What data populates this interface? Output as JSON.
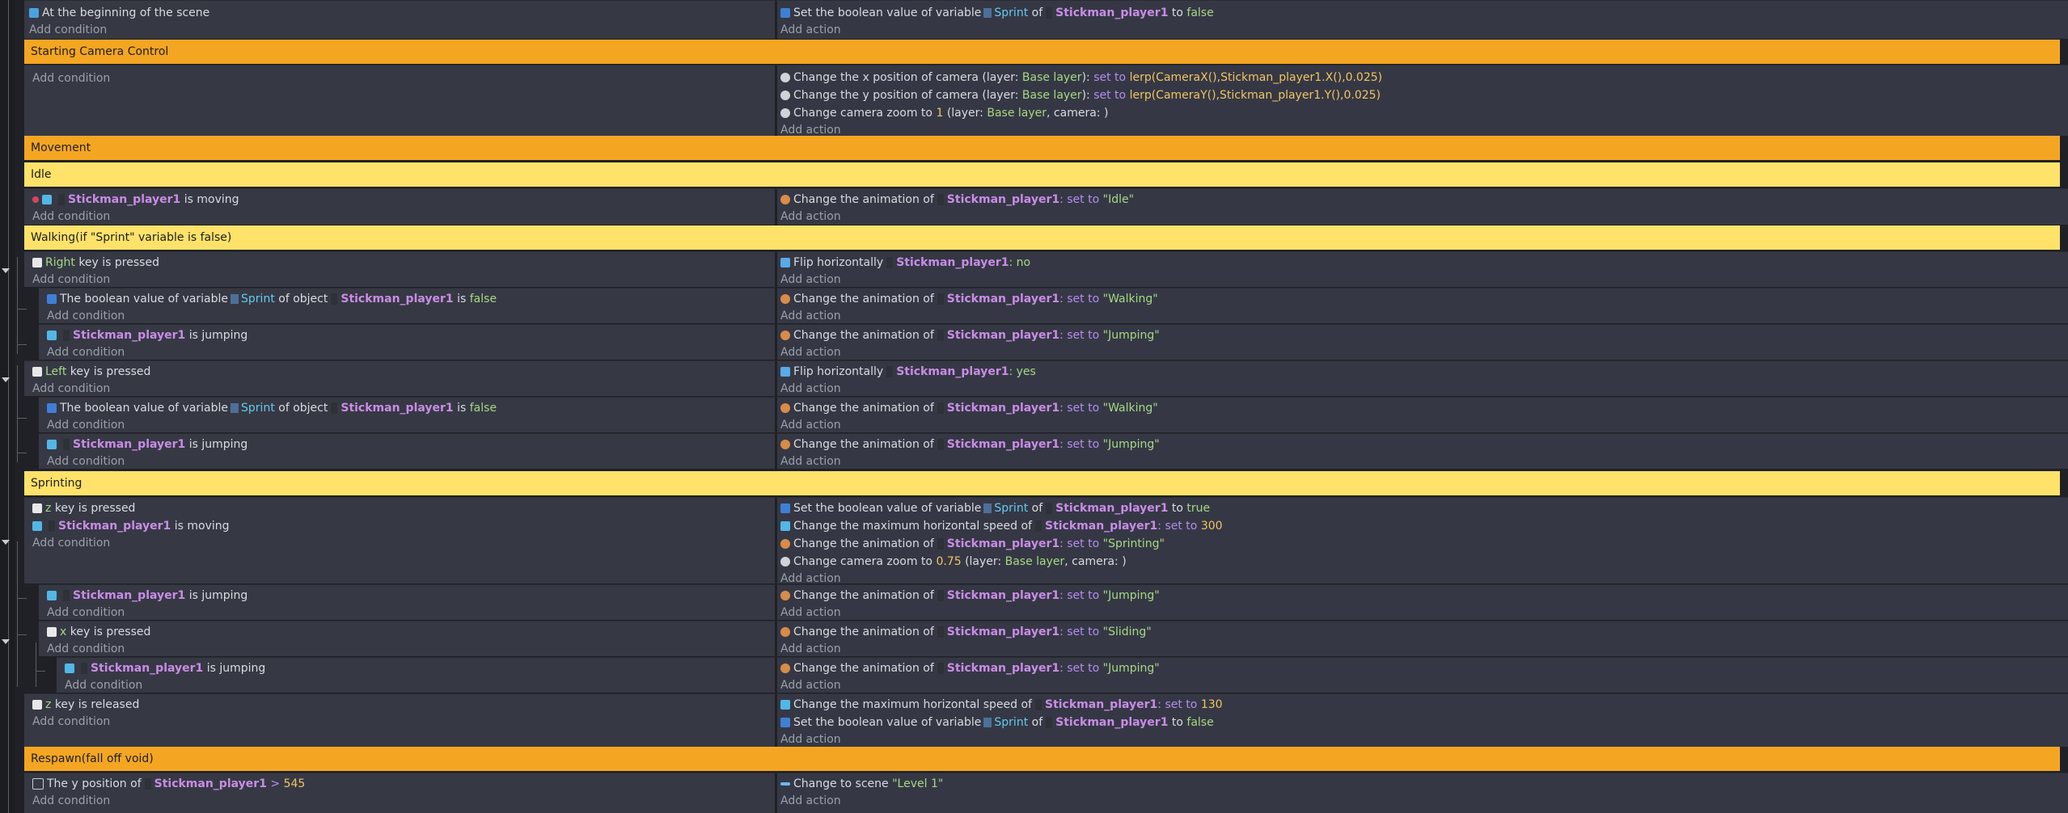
{
  "add_condition": "Add condition",
  "add_action": "Add action",
  "events": {
    "e1": {
      "cond_text": "At the beginning of the scene",
      "a1": {
        "pre": "Set the boolean value of variable",
        "var": "Sprint",
        "of": "of",
        "obj": "Stickman_player1",
        "to": "to",
        "val": "false"
      }
    },
    "g_camera": "Starting Camera Control",
    "e2": {
      "a1": {
        "pre": "Change the x position of camera",
        "l1": "(layer:",
        "layer": "Base layer",
        "l2": "):",
        "set": "set to",
        "expr": "lerp(CameraX(),Stickman_player1.X(),0.025)"
      },
      "a2": {
        "pre": "Change the y position of camera",
        "l1": "(layer:",
        "layer": "Base layer",
        "l2": "):",
        "set": "set to",
        "expr": "lerp(CameraY(),Stickman_player1.Y(),0.025)"
      },
      "a3": {
        "pre": "Change camera zoom to",
        "num": "1",
        "l1": "(layer:",
        "layer": "Base layer",
        "l2": ", camera:",
        "l3": ")"
      }
    },
    "g_movement": "Movement",
    "g_idle": "Idle",
    "e3": {
      "c_obj": "Stickman_player1",
      "c_txt": "is moving",
      "a1": {
        "pre": "Change the animation of",
        "obj": "Stickman_player1",
        "set": ": set to",
        "val": "\"Idle\""
      }
    },
    "g_walking": "Walking(if \"Sprint\" variable is false)",
    "e4": {
      "c_key": "Right",
      "c_txt": "key is pressed",
      "a1": {
        "pre": "Flip horizontally",
        "obj": "Stickman_player1",
        "val": ": no"
      }
    },
    "e5": {
      "c_pre": "The boolean value of variable",
      "c_var": "Sprint",
      "c_of": "of object",
      "c_obj": "Stickman_player1",
      "c_is": "is",
      "c_val": "false",
      "a1": {
        "pre": "Change the animation of",
        "obj": "Stickman_player1",
        "set": ": set to",
        "val": "\"Walking\""
      }
    },
    "e6": {
      "c_obj": "Stickman_player1",
      "c_txt": "is jumping",
      "a1": {
        "pre": "Change the animation of",
        "obj": "Stickman_player1",
        "set": ": set to",
        "val": "\"Jumping\""
      }
    },
    "e7": {
      "c_key": "Left",
      "c_txt": "key is pressed",
      "a1": {
        "pre": "Flip horizontally",
        "obj": "Stickman_player1",
        "val": ": yes"
      }
    },
    "e8": {
      "c_pre": "The boolean value of variable",
      "c_var": "Sprint",
      "c_of": "of object",
      "c_obj": "Stickman_player1",
      "c_is": "is",
      "c_val": "false",
      "a1": {
        "pre": "Change the animation of",
        "obj": "Stickman_player1",
        "set": ": set to",
        "val": "\"Walking\""
      }
    },
    "e9": {
      "c_obj": "Stickman_player1",
      "c_txt": "is jumping",
      "a1": {
        "pre": "Change the animation of",
        "obj": "Stickman_player1",
        "set": ": set to",
        "val": "\"Jumping\""
      }
    },
    "g_sprinting": "Sprinting",
    "e10": {
      "c1_key": "z",
      "c1_txt": "key is pressed",
      "c2_obj": "Stickman_player1",
      "c2_txt": "is moving",
      "a1": {
        "pre": "Set the boolean value of variable",
        "var": "Sprint",
        "of": "of",
        "obj": "Stickman_player1",
        "to": "to",
        "val": "true"
      },
      "a2": {
        "pre": "Change the maximum horizontal speed of",
        "obj": "Stickman_player1",
        "set": ": set to",
        "val": "300"
      },
      "a3": {
        "pre": "Change the animation of",
        "obj": "Stickman_player1",
        "set": ": set to",
        "val": "\"Sprinting\""
      },
      "a4": {
        "pre": "Change camera zoom to",
        "num": "0.75",
        "l1": "(layer:",
        "layer": "Base layer",
        "l2": ", camera:",
        "l3": ")"
      }
    },
    "e11": {
      "c_obj": "Stickman_player1",
      "c_txt": "is jumping",
      "a1": {
        "pre": "Change the animation of",
        "obj": "Stickman_player1",
        "set": ": set to",
        "val": "\"Jumping\""
      }
    },
    "e12": {
      "c_key": "x",
      "c_txt": "key is pressed",
      "a1": {
        "pre": "Change the animation of",
        "obj": "Stickman_player1",
        "set": ": set to",
        "val": "\"Sliding\""
      }
    },
    "e13": {
      "c_obj": "Stickman_player1",
      "c_txt": "is jumping",
      "a1": {
        "pre": "Change the animation of",
        "obj": "Stickman_player1",
        "set": ": set to",
        "val": "\"Jumping\""
      }
    },
    "e14": {
      "c_key": "z",
      "c_txt": "key is released",
      "a1": {
        "pre": "Change the maximum horizontal speed of",
        "obj": "Stickman_player1",
        "set": ": set to",
        "val": "130"
      },
      "a2": {
        "pre": "Set the boolean value of variable",
        "var": "Sprint",
        "of": "of",
        "obj": "Stickman_player1",
        "to": "to",
        "val": "false"
      }
    },
    "g_respawn": "Respawn(fall off void)",
    "e15": {
      "c_pre": "The y position of",
      "c_obj": "Stickman_player1",
      "c_op": ">",
      "c_val": "545",
      "a1": {
        "pre": "Change to scene",
        "val": "\"Level 1\""
      }
    }
  }
}
